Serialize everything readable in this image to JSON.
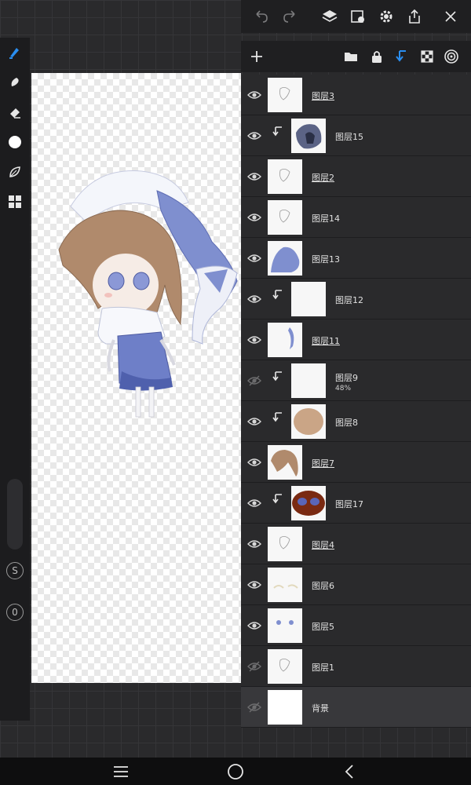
{
  "colors": {
    "accent": "#2a8ef0",
    "panel": "#2a2a2c",
    "background_layer": "#38383b"
  },
  "layers": [
    {
      "name": "图层3",
      "visible": true,
      "clipped": false,
      "underlined": true,
      "thumb": "white-sketch"
    },
    {
      "name": "图层15",
      "visible": true,
      "clipped": true,
      "underlined": false,
      "thumb": "dark-blob"
    },
    {
      "name": "图层2",
      "visible": true,
      "clipped": false,
      "underlined": true,
      "thumb": "white-sketch"
    },
    {
      "name": "图层14",
      "visible": true,
      "clipped": false,
      "underlined": false,
      "thumb": "white-sketch"
    },
    {
      "name": "图层13",
      "visible": true,
      "clipped": false,
      "underlined": false,
      "thumb": "blue-blob"
    },
    {
      "name": "图层12",
      "visible": true,
      "clipped": true,
      "underlined": false,
      "thumb": "blank"
    },
    {
      "name": "图层11",
      "visible": true,
      "clipped": false,
      "underlined": true,
      "thumb": "blue-stroke"
    },
    {
      "name": "图层9",
      "visible": false,
      "clipped": true,
      "underlined": false,
      "thumb": "blank",
      "opacity": "48%"
    },
    {
      "name": "图层8",
      "visible": true,
      "clipped": true,
      "underlined": false,
      "thumb": "skin-blob"
    },
    {
      "name": "图层7",
      "visible": true,
      "clipped": false,
      "underlined": true,
      "thumb": "hair"
    },
    {
      "name": "图层17",
      "visible": true,
      "clipped": true,
      "underlined": false,
      "thumb": "brown-eyes"
    },
    {
      "name": "图层4",
      "visible": true,
      "clipped": false,
      "underlined": true,
      "thumb": "white-sketch"
    },
    {
      "name": "图层6",
      "visible": true,
      "clipped": false,
      "underlined": false,
      "thumb": "faint"
    },
    {
      "name": "图层5",
      "visible": true,
      "clipped": false,
      "underlined": false,
      "thumb": "blue-dots"
    },
    {
      "name": "图层1",
      "visible": false,
      "clipped": false,
      "underlined": false,
      "thumb": "white-sketch"
    },
    {
      "name": "背景",
      "visible": false,
      "clipped": false,
      "underlined": false,
      "thumb": "white",
      "is_background": true
    }
  ],
  "left_tools": [
    "brush-icon",
    "smudge-icon",
    "eraser-icon",
    "color-icon",
    "leaf-icon",
    "grid-icon"
  ],
  "side_buttons": {
    "s_label": "S",
    "o_label": "0"
  }
}
